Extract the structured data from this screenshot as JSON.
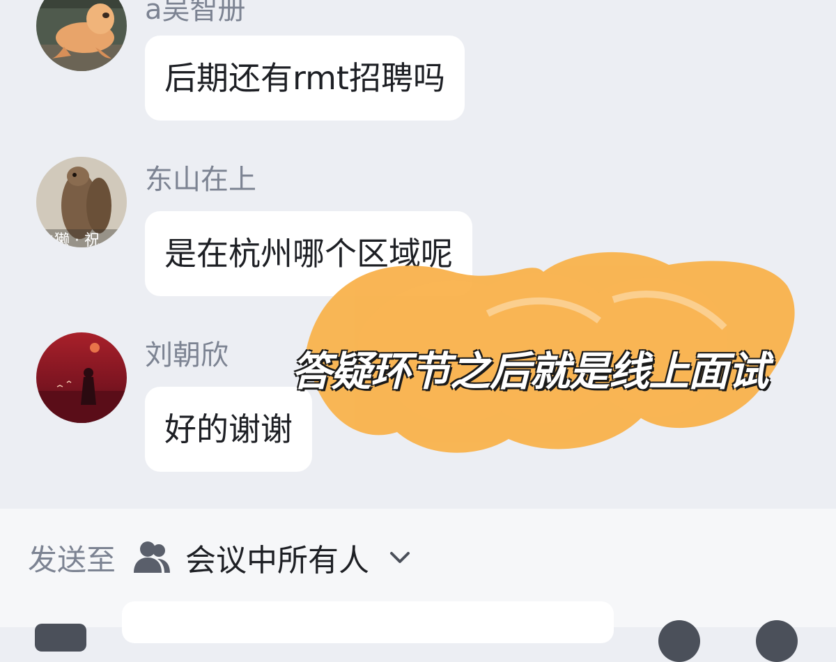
{
  "messages": [
    {
      "sender": "a吴智册",
      "text": "后期还有rmt招聘吗",
      "avatar_icon": "sea-lion-avatar"
    },
    {
      "sender": "东山在上",
      "text": "是在杭州哪个区域呢",
      "avatar_icon": "otter-avatar",
      "avatar_caption": "水獭 · 祝"
    },
    {
      "sender": "刘朝欣",
      "text": "好的谢谢",
      "avatar_icon": "sunset-figure-avatar"
    }
  ],
  "overlay": {
    "caption": "答疑环节之后就是线上面试",
    "highlight_color": "#f9b24c"
  },
  "composer": {
    "send_to_label": "发送至",
    "recipient_icon": "people-icon",
    "recipient": "会议中所有人",
    "dropdown_icon": "chevron-down-icon"
  },
  "colors": {
    "background": "#eceef3",
    "bubble": "#ffffff",
    "name_text": "#7c8392",
    "message_text": "#1d1f24",
    "panel": "#f6f7f9"
  }
}
